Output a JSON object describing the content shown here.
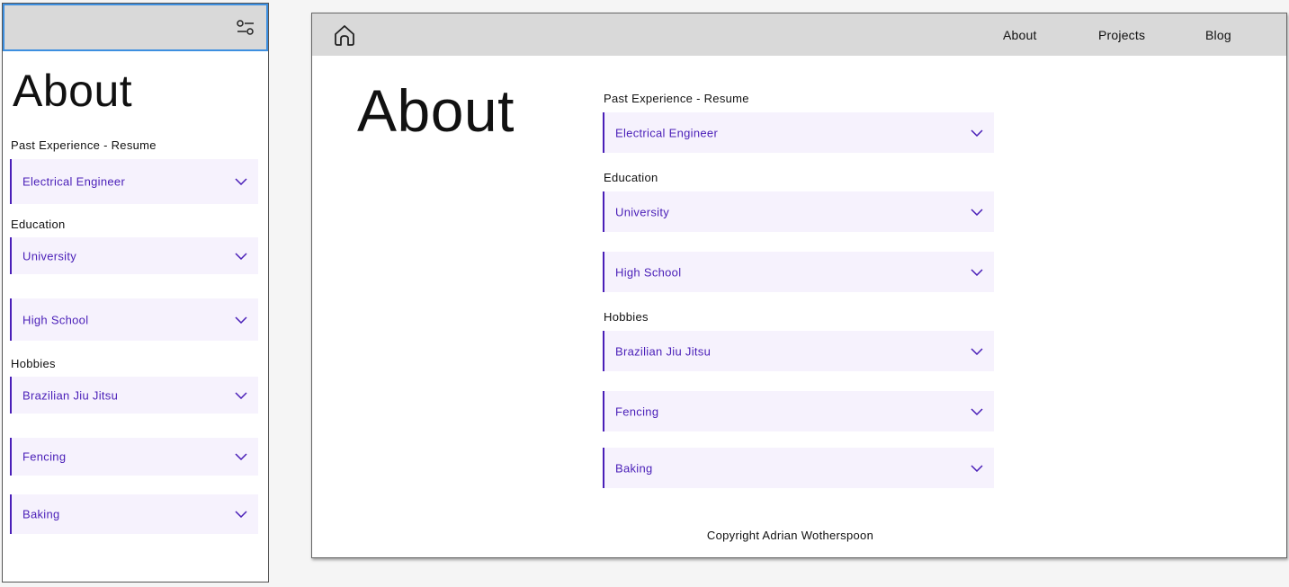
{
  "mobile": {
    "menu_icon": "sliders-icon",
    "title": "About",
    "sections": {
      "experience": "Past Experience - Resume",
      "education": "Education",
      "hobbies": "Hobbies"
    },
    "items": {
      "electrical": "Electrical Engineer",
      "university": "University",
      "high_school": "High School",
      "bjj": "Brazilian Jiu Jitsu",
      "fencing": "Fencing",
      "baking": "Baking"
    }
  },
  "desktop": {
    "home_icon": "home-icon",
    "nav": {
      "about": "About",
      "projects": "Projects",
      "blog": "Blog"
    },
    "title": "About",
    "sections": {
      "experience": "Past Experience - Resume",
      "education": "Education",
      "hobbies": "Hobbies"
    },
    "items": {
      "electrical": "Electrical Engineer",
      "university": "University",
      "high_school": "High School",
      "bjj": "Brazilian Jiu Jitsu",
      "fencing": "Fencing",
      "baking": "Baking"
    },
    "footer": "Copyright Adrian Wotherspoon"
  },
  "colors": {
    "accent": "#4a1fb8",
    "accordion_bg": "#f6f2fd",
    "header_bg": "#d9d9d9",
    "selection_outline": "#3d8fe0"
  }
}
